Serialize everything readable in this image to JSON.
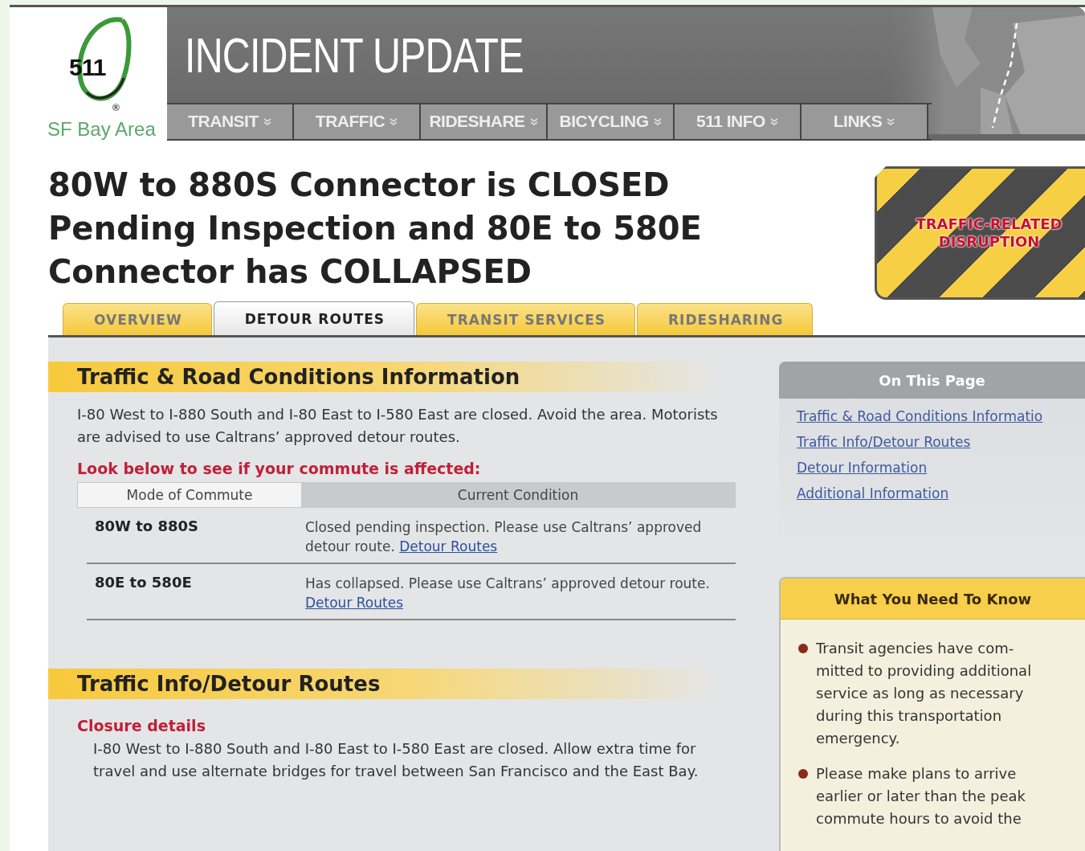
{
  "logo": {
    "number": "511",
    "mark": "®",
    "region": "SF Bay Area"
  },
  "banner": {
    "title": "INCIDENT UPDATE"
  },
  "nav": [
    {
      "label": "TRANSIT"
    },
    {
      "label": "TRAFFIC"
    },
    {
      "label": "RIDESHARE"
    },
    {
      "label": "BICYCLING"
    },
    {
      "label": "511 INFO"
    },
    {
      "label": "LINKS"
    }
  ],
  "headline": "80W to 880S Connector is CLOSED Pending Inspection and 80E to 580E Connector has COLLAPSED",
  "badge": "TRAFFIC-RELATED DISRUPTION",
  "tabs": [
    {
      "label": "OVERVIEW",
      "selected": false
    },
    {
      "label": "DETOUR ROUTES",
      "selected": true
    },
    {
      "label": "TRANSIT SERVICES",
      "selected": false
    },
    {
      "label": "RIDESHARING",
      "selected": false
    }
  ],
  "sections": [
    {
      "kind": "conditions",
      "title": "Traffic & Road Conditions Information",
      "intro": "I-80 West to I-880 South and I-80 East to I-580 East are closed. Avoid the area. Motorists are advised to use Caltrans’ approved detour routes.",
      "alert": "Look below to see if your commute is affected:",
      "table": {
        "columns": [
          "Mode of Commute",
          "Current Condition"
        ],
        "rows": [
          {
            "route": "80W to 880S",
            "condition": "Closed pending inspection. Please use Caltrans’ approved detour route.",
            "link": "Detour Routes"
          },
          {
            "route": "80E to 580E",
            "condition": "Has collapsed. Please use Caltrans’ approved detour route.",
            "link": "Detour Routes"
          }
        ]
      }
    },
    {
      "kind": "details",
      "title": "Traffic Info/Detour Routes",
      "subtitle": "Closure details",
      "body": "I-80 West to I-880 South and I-80 East to I-580 East are closed. Allow extra time for travel and use alternate bridges for travel between San Francisco and the East Bay."
    }
  ],
  "on_this_page": {
    "title": "On This Page",
    "links": [
      "Traffic & Road Conditions Informatio",
      "Traffic Info/Detour Routes",
      "Detour Information",
      "Additional Information"
    ]
  },
  "need_to_know": {
    "title": "What You Need To Know",
    "items": [
      "Transit agencies have com-mitted to providing additional service as long as necessary during this transportation emergency.",
      "Please make plans to arrive earlier or later than the peak commute hours to avoid the"
    ]
  }
}
